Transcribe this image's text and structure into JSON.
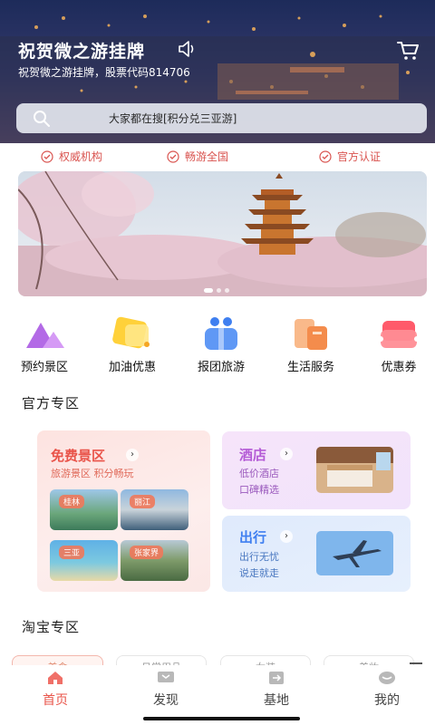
{
  "header": {
    "title": "祝贺微之游挂牌",
    "subtitle": "祝贺微之游挂牌，股票代码814706",
    "search_placeholder": "大家都在搜[积分兑三亚游]"
  },
  "badges": [
    "权威机构",
    "畅游全国",
    "官方认证"
  ],
  "quick_nav": [
    {
      "label": "预约景区",
      "icon": "mountain-icon"
    },
    {
      "label": "加油优惠",
      "icon": "fuel-icon"
    },
    {
      "label": "报团旅游",
      "icon": "group-icon"
    },
    {
      "label": "生活服务",
      "icon": "service-icon"
    },
    {
      "label": "优惠券",
      "icon": "coupon-icon"
    }
  ],
  "sections": {
    "official": "官方专区",
    "taobao": "淘宝专区"
  },
  "official": {
    "free": {
      "title": "免费景区",
      "subtitle": "旅游景区 积分畅玩",
      "tags": [
        "桂林",
        "丽江",
        "三亚",
        "张家界"
      ]
    },
    "hotel": {
      "title": "酒店",
      "lines": [
        "低价酒店",
        "口碑精选"
      ]
    },
    "trip": {
      "title": "出行",
      "lines": [
        "出行无忧",
        "说走就走"
      ]
    }
  },
  "taobao_tabs": [
    "美食",
    "日常用品",
    "女装",
    "美妆"
  ],
  "bottom_nav": [
    {
      "label": "首页",
      "icon": "home-icon",
      "active": true
    },
    {
      "label": "发现",
      "icon": "discover-icon",
      "active": false
    },
    {
      "label": "基地",
      "icon": "base-icon",
      "active": false
    },
    {
      "label": "我的",
      "icon": "profile-icon",
      "active": false
    }
  ],
  "colors": {
    "accent": "#e9544a",
    "badge": "#d9534f"
  }
}
